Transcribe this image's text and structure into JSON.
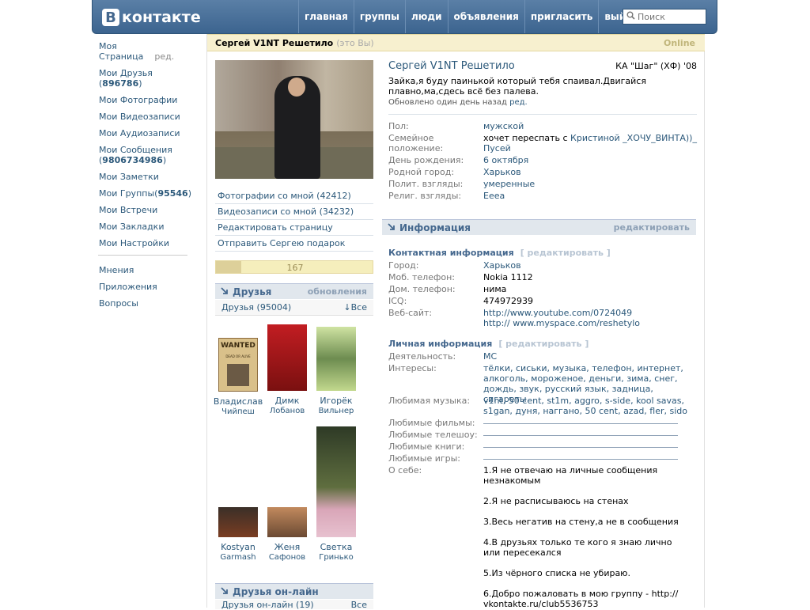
{
  "logo": {
    "b": "В",
    "text": "контакте"
  },
  "topnav": [
    "главная",
    "группы",
    "люди",
    "объявления",
    "пригласить",
    "выйти"
  ],
  "search": {
    "placeholder": "Поиск"
  },
  "leftnav": {
    "my_page": "Моя Страница",
    "edit": "ред.",
    "friends_label": "Мои Друзья",
    "friends_count": "896786",
    "photos": "Мои Фотографии",
    "videos": "Мои Видеозаписи",
    "audio": "Мои Аудиозаписи",
    "messages_label": "Мои Сообщения",
    "messages_count": "9806734986",
    "notes": "Мои Заметки",
    "groups_label": "Мои Группы",
    "groups_count": "95546",
    "events": "Мои Встречи",
    "bookmarks": "Мои Закладки",
    "settings": "Мои Настройки",
    "opinions": "Мнения",
    "apps": "Приложения",
    "questions": "Вопросы"
  },
  "header": {
    "name": "Сергей V1NT Решетило",
    "you": "(это Вы)",
    "online": "Online"
  },
  "actions": [
    "Фотографии со мной (42412)",
    "Видеозаписи со мной (34232)",
    "Редактировать страницу",
    "Отправить Сергею подарок"
  ],
  "rating": {
    "value": "167",
    "fill_fraction": 0.16
  },
  "friends": {
    "title": "Друзья",
    "updates": "обновления",
    "count_label": "Друзья (95004)",
    "all": "Все",
    "list": [
      {
        "first": "Владислав",
        "last": "Чийпеш"
      },
      {
        "first": "Димк",
        "last": "Лобанов"
      },
      {
        "first": "Игорёк",
        "last": "Вильнер"
      },
      {
        "first": "Kostyan",
        "last": "Garmash"
      },
      {
        "first": "Женя",
        "last": "Сафонов"
      },
      {
        "first": "Светка",
        "last": "Гринько"
      }
    ],
    "wanted_text": "WANTED",
    "wanted_sub": "DEAD OR ALIVE"
  },
  "online_friends": {
    "title": "Друзья он-лайн",
    "count_label": "Друзья он-лайн (19)",
    "all": "Все"
  },
  "profile": {
    "name": "Сергей V1NT Решетило",
    "school": "КА \"Шаг\" (ХФ) '08",
    "status": "Зайка,я буду паинькой который тебя спаивал.Двигайся плавно,ма,сдесь всё без палева.",
    "updated": "Обновлено один день назад",
    "updated_edit": "ред.",
    "sex_k": "Пол:",
    "sex_v": "мужской",
    "family_k": "Семейное положение:",
    "family_v1": "хочет переспать с",
    "family_v2": "Кристиной _ХОЧУ_ВИНТА))_ Пусей",
    "bday_k": "День рождения:",
    "bday_v": "6 октября",
    "city_k": "Родной город:",
    "city_v": "Харьков",
    "polit_k": "Полит. взгляды:",
    "polit_v": "умеренные",
    "relig_k": "Религ. взгляды:",
    "relig_v": "Еееа"
  },
  "info": {
    "title": "Информация",
    "edit": "редактировать",
    "contact_title": "Контактная информация",
    "contact_edit": "[ редактировать ]",
    "town_k": "Город:",
    "town_v": "Харьков",
    "mob_k": "Моб. телефон:",
    "mob_v": "Nokia 1112",
    "home_k": "Дом. телефон:",
    "home_v": "нима",
    "icq_k": "ICQ:",
    "icq_v": "474972939",
    "web_k": "Веб-сайт:",
    "web_v": "http://www.youtube.com/0724049 http:// www.myspace.com/reshetylo",
    "personal_title": "Личная информация",
    "personal_edit": "[ редактировать ]",
    "activity_k": "Деятельность:",
    "activity_v": "MC",
    "interests_k": "Интересы:",
    "interests_v": "тёлки, сиськи, музыка, телефон, интернет, алкоголь, мороженое, деньги, зима, снег, дождь, звук, русский язык, задница, сигареты",
    "music_k": "Любимая музыка:",
    "music_v": "v1nt, 50 cent, st1m, aggro, s-side, kool savas, s1gan, дуня, наггано, 50 cent, azad, fler, sido",
    "films_k": "Любимые фильмы:",
    "tv_k": "Любимые телешоу:",
    "books_k": "Любимые книги:",
    "games_k": "Любимые игры:",
    "about_k": "О себе:",
    "about": [
      "1.Я не отвечаю на личные сообщения незнакомым",
      "2.Я не расписываюсь на стенах",
      "3.Весь негатив на стену,а не в сообщения",
      "4.В друзьях только те кого я знаю лично или пересекался",
      "5.Из чёрного списка не убираю.",
      "6.Добро пожаловать в мою группу - http:// vkontakte.ru/club5536753"
    ]
  }
}
